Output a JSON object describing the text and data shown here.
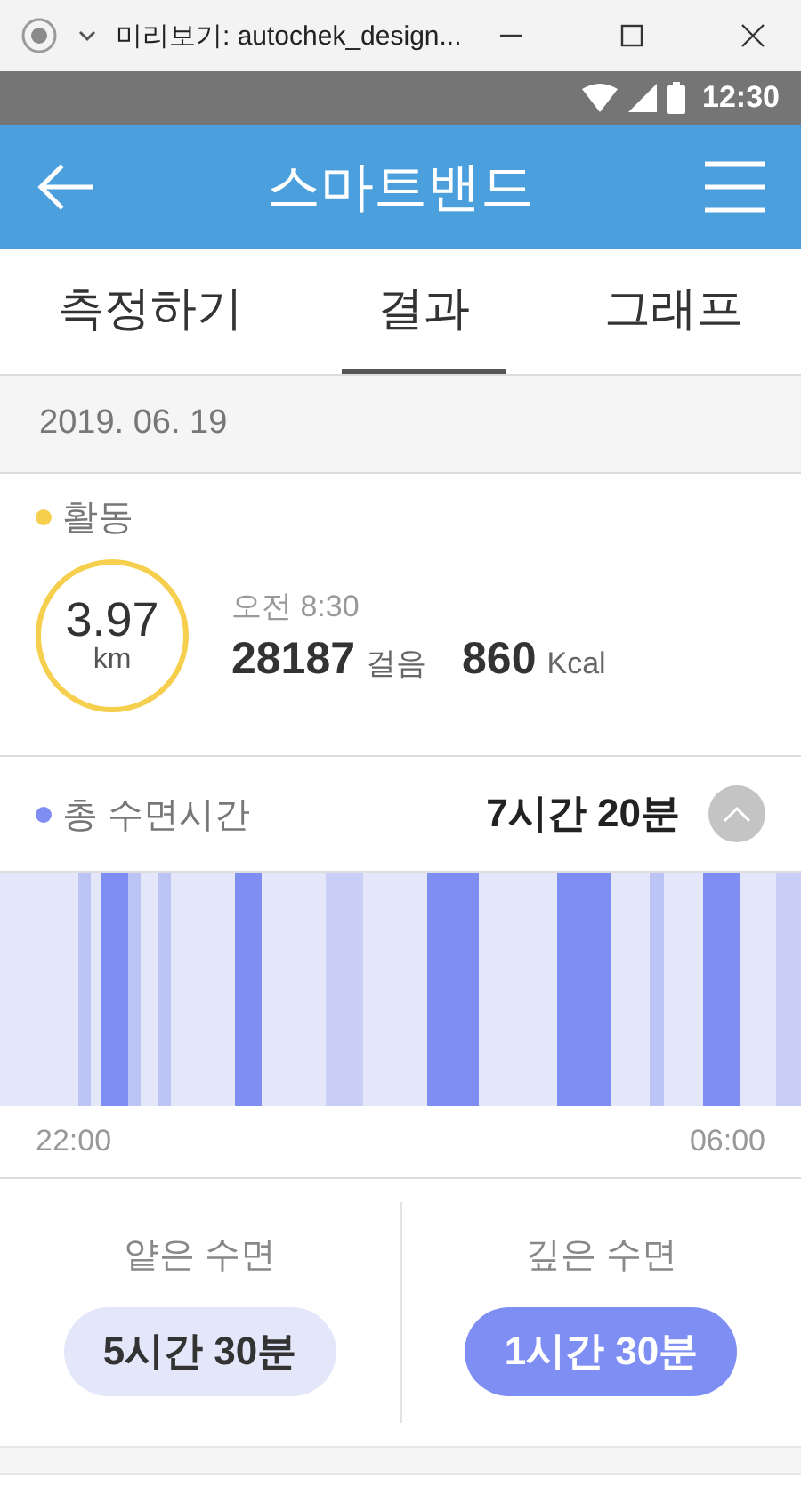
{
  "window": {
    "title": "미리보기: autochek_design..."
  },
  "status_bar": {
    "time": "12:30"
  },
  "header": {
    "title": "스마트밴드"
  },
  "tabs": [
    {
      "label": "측정하기",
      "selected": false
    },
    {
      "label": "결과",
      "selected": true
    },
    {
      "label": "그래프",
      "selected": false
    }
  ],
  "date": "2019. 06. 19",
  "activity": {
    "title": "활동",
    "color": "#f5cf4d",
    "distance": "3.97",
    "distance_unit": "km",
    "time": "오전 8:30",
    "steps": "28187",
    "steps_unit": "걸음",
    "calories": "860",
    "calories_unit": "Kcal"
  },
  "sleep": {
    "title": "총 수면시간",
    "color": "#7f8ef2",
    "total": "7시간 20분",
    "expanded": true,
    "start_label": "22:00",
    "end_label": "06:00",
    "stages": [
      {
        "label": "얕은 수면",
        "value": "5시간 30분",
        "kind": "light"
      },
      {
        "label": "깊은 수면",
        "value": "1시간 30분",
        "kind": "deep"
      }
    ]
  }
}
